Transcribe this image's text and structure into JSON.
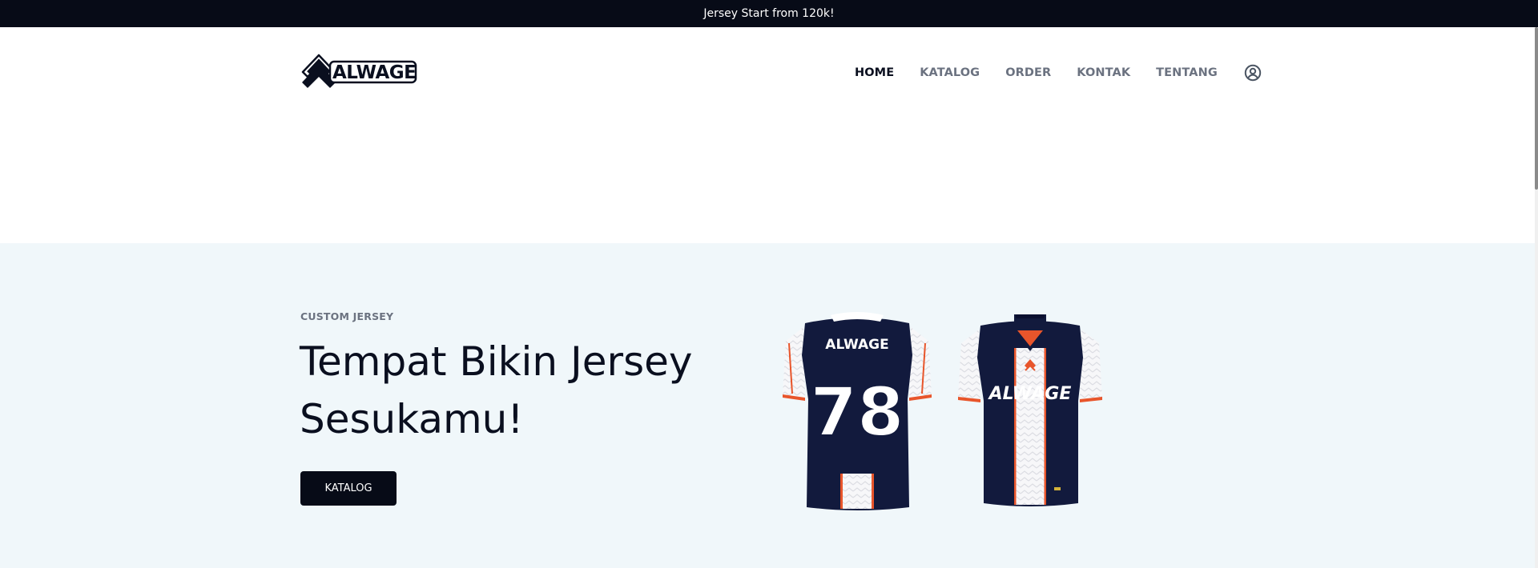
{
  "announcement": "Jersey Start from 120k!",
  "brand": {
    "logo_text": "ALWAGE"
  },
  "nav": {
    "items": [
      {
        "label": "HOME",
        "active": true
      },
      {
        "label": "KATALOG",
        "active": false
      },
      {
        "label": "ORDER",
        "active": false
      },
      {
        "label": "KONTAK",
        "active": false
      },
      {
        "label": "TENTANG",
        "active": false
      }
    ],
    "account_icon": "user-circle-icon"
  },
  "hero": {
    "eyebrow": "CUSTOM JERSEY",
    "headline": "Tempat Bikin Jersey Sesukamu!",
    "cta_label": "KATALOG",
    "jersey_back": {
      "name_print": "ALWAGE",
      "number": "78"
    },
    "jersey_front": {
      "chest_print": "ALWAGE"
    }
  },
  "colors": {
    "topbar": "#070b17",
    "hero_bg": "#f0f7fa",
    "jersey_navy": "#121a3d",
    "jersey_accent": "#e8552b",
    "nav_muted": "#6b7280"
  }
}
